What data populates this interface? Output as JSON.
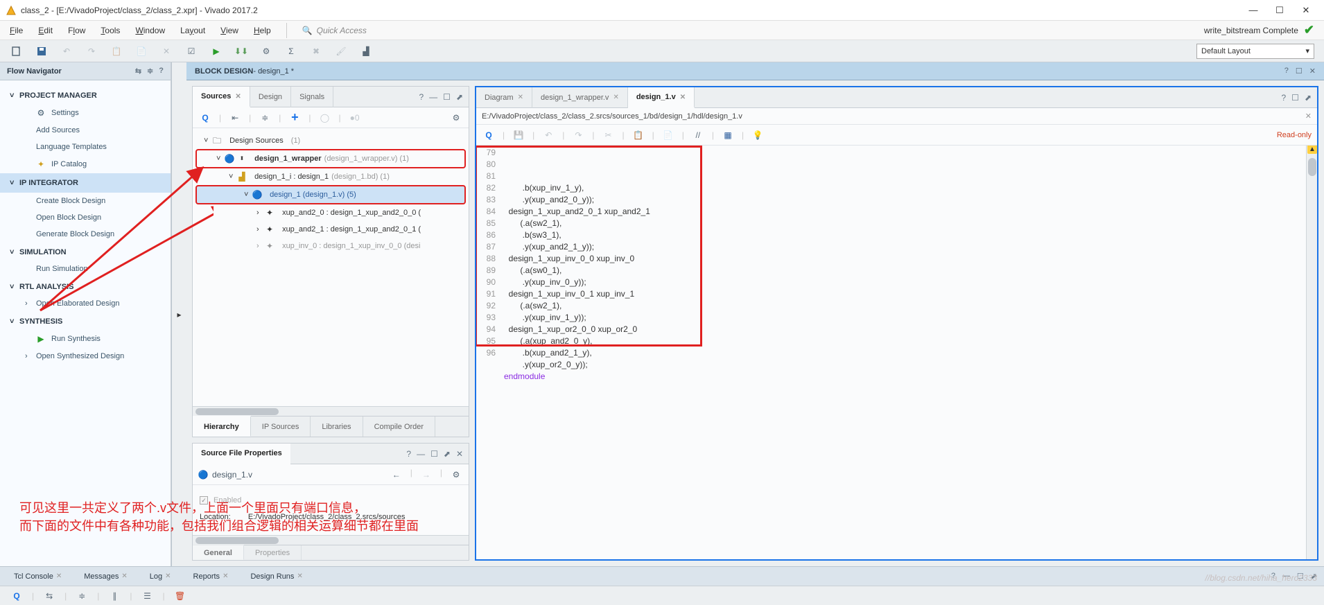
{
  "window": {
    "title": "class_2 - [E:/VivadoProject/class_2/class_2.xpr] - Vivado 2017.2",
    "status": "write_bitstream Complete"
  },
  "menus": [
    "File",
    "Edit",
    "Flow",
    "Tools",
    "Window",
    "Layout",
    "View",
    "Help"
  ],
  "quick_access": "Quick Access",
  "layout_combo": "Default Layout",
  "navigator": {
    "title": "Flow Navigator",
    "sections": [
      {
        "label": "PROJECT MANAGER",
        "items": [
          {
            "label": "Settings",
            "icon": "gear-icon"
          },
          {
            "label": "Add Sources",
            "icon": ""
          },
          {
            "label": "Language Templates",
            "icon": ""
          },
          {
            "label": "IP Catalog",
            "icon": "ip-icon"
          }
        ]
      },
      {
        "label": "IP INTEGRATOR",
        "sel": true,
        "items": [
          {
            "label": "Create Block Design",
            "icon": ""
          },
          {
            "label": "Open Block Design",
            "icon": ""
          },
          {
            "label": "Generate Block Design",
            "icon": ""
          }
        ]
      },
      {
        "label": "SIMULATION",
        "items": [
          {
            "label": "Run Simulation",
            "icon": ""
          }
        ]
      },
      {
        "label": "RTL ANALYSIS",
        "items": [
          {
            "label": "Open Elaborated Design",
            "icon": "",
            "caret": ">"
          }
        ]
      },
      {
        "label": "SYNTHESIS",
        "items": [
          {
            "label": "Run Synthesis",
            "icon": "play-icon"
          },
          {
            "label": "Open Synthesized Design",
            "icon": "",
            "caret": ">"
          }
        ]
      }
    ]
  },
  "block_design": {
    "title_prefix": "BLOCK DESIGN",
    "title_name": " - design_1 *"
  },
  "sources": {
    "tabs": [
      "Sources",
      "Design",
      "Signals"
    ],
    "count0": "0",
    "tree": {
      "root": {
        "label": "Design Sources",
        "count": "(1)"
      },
      "wrapper": {
        "bold": "design_1_wrapper",
        "dim": " (design_1_wrapper.v) (1)"
      },
      "inst": {
        "label": "design_1_i : design_1",
        "dim": " (design_1.bd) (1)"
      },
      "d1": {
        "blue": "design_1 (design_1.v) (5)"
      },
      "c1": {
        "label": "xup_and2_0 : design_1_xup_and2_0_0 ("
      },
      "c2": {
        "label": "xup_and2_1 : design_1_xup_and2_0_1 ("
      },
      "c3": {
        "label": "xup_inv_0 : design_1_xup_inv_0_0 (desi"
      }
    },
    "btabs": [
      "Hierarchy",
      "IP Sources",
      "Libraries",
      "Compile Order"
    ]
  },
  "props": {
    "title": "Source File Properties",
    "file": "design_1.v",
    "enabled": "Enabled",
    "loc_label": "Location:",
    "loc_val": "E:/VivadoProject/class_2/class_2.srcs/sources"
  },
  "editor": {
    "tabs": [
      {
        "label": "Diagram"
      },
      {
        "label": "design_1_wrapper.v"
      },
      {
        "label": "design_1.v",
        "active": true
      }
    ],
    "path": "E:/VivadoProject/class_2/class_2.srcs/sources_1/bd/design_1/hdl/design_1.v",
    "readonly": "Read-only",
    "lines": [
      {
        "n": 79,
        "t": "        .b(xup_inv_1_y),"
      },
      {
        "n": 80,
        "t": "        .y(xup_and2_0_y));"
      },
      {
        "n": 81,
        "t": "  design_1_xup_and2_0_1 xup_and2_1"
      },
      {
        "n": 82,
        "t": "       (.a(sw2_1),"
      },
      {
        "n": 83,
        "t": "        .b(sw3_1),"
      },
      {
        "n": 84,
        "t": "        .y(xup_and2_1_y));"
      },
      {
        "n": 85,
        "t": "  design_1_xup_inv_0_0 xup_inv_0"
      },
      {
        "n": 86,
        "t": "       (.a(sw0_1),"
      },
      {
        "n": 87,
        "t": "        .y(xup_inv_0_y));"
      },
      {
        "n": 88,
        "t": "  design_1_xup_inv_0_1 xup_inv_1"
      },
      {
        "n": 89,
        "t": "       (.a(sw2_1),"
      },
      {
        "n": 90,
        "t": "        .y(xup_inv_1_y));"
      },
      {
        "n": 91,
        "t": "  design_1_xup_or2_0_0 xup_or2_0"
      },
      {
        "n": 92,
        "t": "       (.a(xup_and2_0_y),"
      },
      {
        "n": 93,
        "t": "        .b(xup_and2_1_y),"
      },
      {
        "n": 94,
        "t": "        .y(xup_or2_0_y));"
      },
      {
        "n": 95,
        "t": "endmodule",
        "kw": true
      },
      {
        "n": 96,
        "t": ""
      }
    ]
  },
  "bottom_tabs": [
    "Tcl Console",
    "Messages",
    "Log",
    "Reports",
    "Design Runs"
  ],
  "annotation": {
    "line1": "可见这里一共定义了两个.v文件，上面一个里面只有端口信息，",
    "line2": "而下面的文件中有各种功能，包括我们组合逻辑的相关运算细节都在里面"
  },
  "watermark": "//blog.csdn.net/hiha_hero2333"
}
